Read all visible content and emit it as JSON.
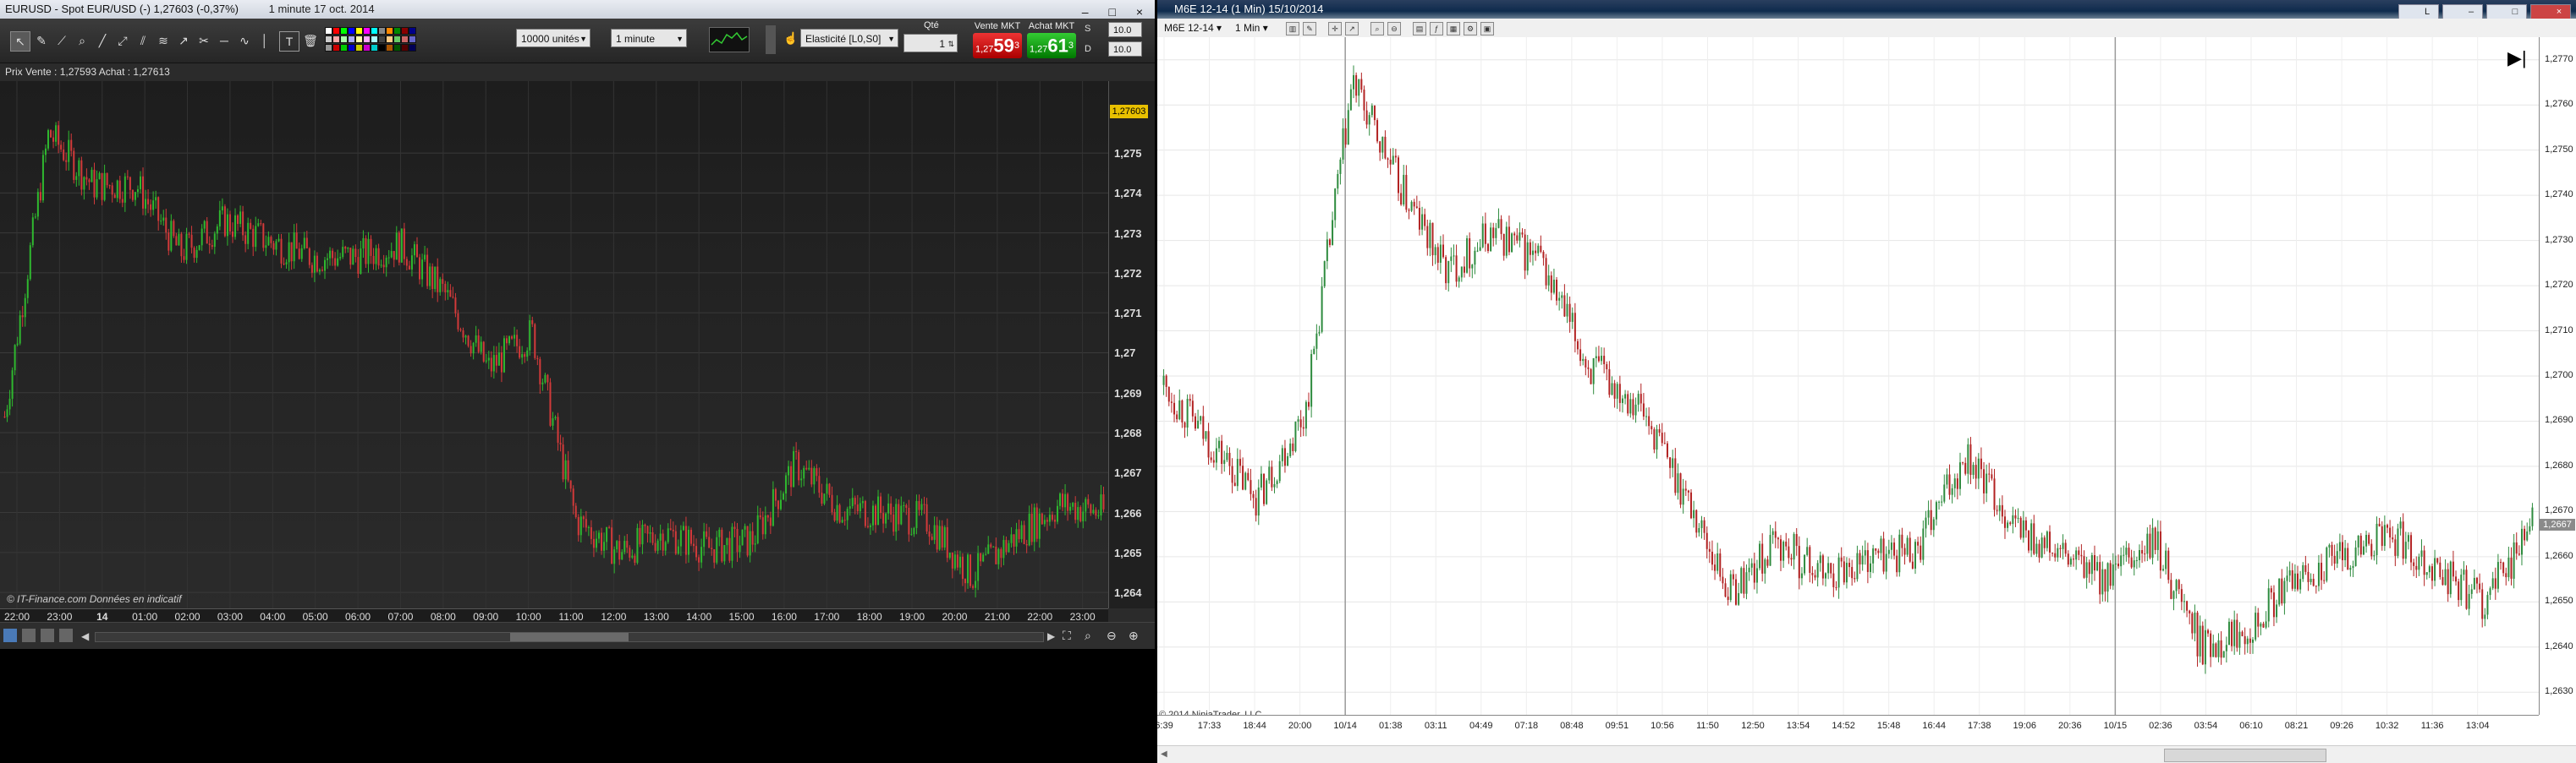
{
  "left_window": {
    "title": "EURUSD - Spot EUR/USD (-)  1,27603 (-0,37%)",
    "interval_title": "1 minute  17 oct. 2014",
    "window_controls": "– □ ×",
    "toolbar": {
      "quantity_units": "10000 unités",
      "timeframe": "1 minute",
      "elasticity": "Elasticité [L0,S0]",
      "qty_label": "Qté",
      "qty_value": "1",
      "s_value": "10.0",
      "d_value": "10.0",
      "s_label": "S",
      "d_label": "D",
      "text_tool": "T"
    },
    "vente": {
      "label": "Vente MKT",
      "small": "1,27",
      "big": "59",
      "sup": "3"
    },
    "achat": {
      "label": "Achat MKT",
      "small": "1,27",
      "big": "61",
      "sup": "3"
    },
    "info": "Prix  Vente : 1,27593  Achat : 1,27613",
    "credit": "© IT-Finance.com  Données en indicatif",
    "last_price": "1,27603",
    "y_ticks": [
      "1,275",
      "1,274",
      "1,273",
      "1,272",
      "1,271",
      "1,27",
      "1,269",
      "1,268",
      "1,267",
      "1,266",
      "1,265",
      "1,264"
    ],
    "x_ticks": [
      "22:00",
      "23:00",
      "14",
      "01:00",
      "02:00",
      "03:00",
      "04:00",
      "05:00",
      "06:00",
      "07:00",
      "08:00",
      "09:00",
      "10:00",
      "11:00",
      "12:00",
      "13:00",
      "14:00",
      "15:00",
      "16:00",
      "17:00",
      "18:00",
      "19:00",
      "20:00",
      "21:00",
      "22:00",
      "23:00"
    ],
    "colors": {
      "up": "#2fb82f",
      "down": "#d23a3a",
      "background": "#262626"
    }
  },
  "right_window": {
    "title": "M6E 12-14 (1 Min)  15/10/2014",
    "instrument": "M6E 12-14",
    "interval": "1 Min",
    "window_controls": "L",
    "credit": "© 2014 NinjaTrader, LLC",
    "last_price": "1,2667",
    "y_ticks": [
      "1,2770",
      "1,2760",
      "1,2750",
      "1,2740",
      "1,2730",
      "1,2720",
      "1,2710",
      "1,2700",
      "1,2690",
      "1,2680",
      "1,2670",
      "1,2660",
      "1,2650",
      "1,2640",
      "1,2630"
    ],
    "x_ticks": [
      "6:39",
      "17:33",
      "18:44",
      "20:00",
      "10/14",
      "01:38",
      "03:11",
      "04:49",
      "07:18",
      "08:48",
      "09:51",
      "10:56",
      "11:50",
      "12:50",
      "13:54",
      "14:52",
      "15:48",
      "16:44",
      "17:38",
      "19:06",
      "20:36",
      "10/15",
      "02:36",
      "03:54",
      "06:10",
      "08:21",
      "09:26",
      "10:32",
      "11:36",
      "13:04"
    ],
    "colors": {
      "up": "#2e8b3e",
      "down": "#b22222",
      "background": "#ffffff"
    }
  },
  "chart_data": [
    {
      "type": "line",
      "title": "EURUSD - Spot EUR/USD",
      "x": [
        "22:00",
        "23:00",
        "00:00",
        "01:00",
        "02:00",
        "03:00",
        "04:00",
        "05:00",
        "06:00",
        "07:00",
        "08:00",
        "09:00",
        "10:00",
        "11:00",
        "12:00",
        "13:00",
        "14:00",
        "15:00",
        "16:00",
        "17:00",
        "18:00",
        "19:00",
        "20:00",
        "21:00",
        "22:00",
        "23:00"
      ],
      "values": [
        1.2684,
        1.2755,
        1.2742,
        1.2742,
        1.2725,
        1.2733,
        1.2728,
        1.2724,
        1.2724,
        1.2727,
        1.2715,
        1.2696,
        1.2705,
        1.2658,
        1.265,
        1.2655,
        1.2651,
        1.2653,
        1.2672,
        1.2661,
        1.266,
        1.2658,
        1.2644,
        1.2654,
        1.2662,
        1.266
      ],
      "ylim": [
        1.2636,
        1.2768
      ],
      "last": 1.27603
    },
    {
      "type": "line",
      "title": "M6E 12-14 (1 Min)",
      "x": [
        "6:39",
        "17:33",
        "18:44",
        "20:00",
        "10/14",
        "01:38",
        "03:11",
        "04:49",
        "07:18",
        "08:48",
        "09:51",
        "10:56",
        "11:50",
        "12:50",
        "13:54",
        "14:52",
        "15:48",
        "16:44",
        "17:38",
        "19:06",
        "20:36",
        "10/15",
        "02:36",
        "03:54",
        "06:10",
        "08:21",
        "09:26",
        "10:32",
        "11:36",
        "13:04"
      ],
      "values": [
        1.2698,
        1.2685,
        1.2673,
        1.2692,
        1.2765,
        1.2742,
        1.2723,
        1.2732,
        1.2725,
        1.2702,
        1.2695,
        1.2675,
        1.2652,
        1.2663,
        1.2656,
        1.266,
        1.2662,
        1.2683,
        1.2667,
        1.266,
        1.2655,
        1.2663,
        1.264,
        1.2645,
        1.2655,
        1.266,
        1.2665,
        1.2657,
        1.265,
        1.2667
      ],
      "ylim": [
        1.2625,
        1.2775
      ],
      "last": 1.2667
    }
  ]
}
